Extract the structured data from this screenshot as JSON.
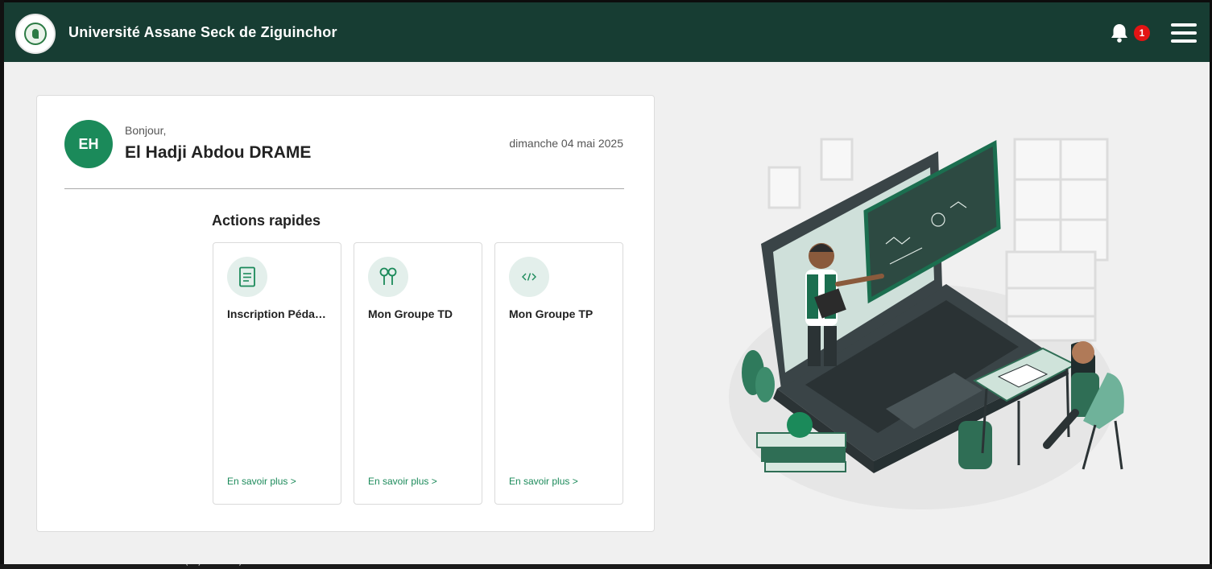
{
  "header": {
    "title": "Université Assane Seck de Ziguinchor",
    "notification_count": "1"
  },
  "welcome": {
    "initials": "EH",
    "greeting": "Bonjour,",
    "name": "El Hadji Abdou DRAME",
    "date": "dimanche 04 mai 2025"
  },
  "quick_actions": {
    "title": "Actions rapides",
    "items": [
      {
        "label": "Inscription Pédagogique",
        "link": "En savoir plus >",
        "icon": "document-icon"
      },
      {
        "label": "Mon Groupe TD",
        "link": "En savoir plus >",
        "icon": "people-icon"
      },
      {
        "label": "Mon Groupe TP",
        "link": "En savoir plus >",
        "icon": "code-icon"
      }
    ]
  },
  "colors": {
    "header_bg": "#173d33",
    "accent": "#1b8a5a",
    "badge": "#e31414"
  },
  "background_text": "count(n) o.id)"
}
